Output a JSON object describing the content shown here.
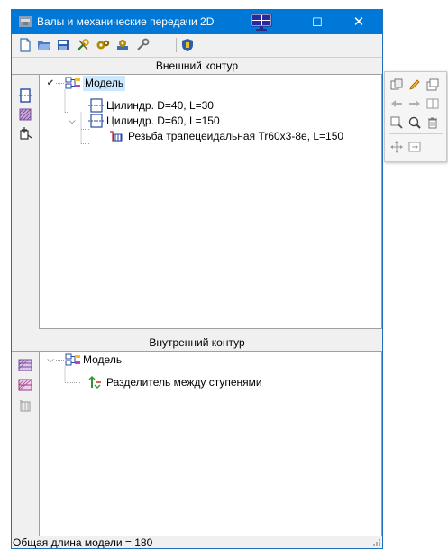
{
  "window": {
    "title": "Валы и механические передачи 2D",
    "buttons": {
      "maximize": "☐",
      "close": "✕"
    }
  },
  "toolbar": {
    "items": [
      "new-file-icon",
      "open-folder-icon",
      "save-icon",
      "tools-icon",
      "gears-icon",
      "settings-gear-icon",
      "wrench-icon",
      "library-icon"
    ]
  },
  "outer": {
    "header": "Внешний контур",
    "tree": {
      "root": "Модель",
      "children": [
        {
          "label": "Цилиндр. D=40, L=30"
        },
        {
          "label": "Цилиндр. D=60, L=150",
          "children": [
            {
              "label": "Резьба трапецеидальная Tr60x3-8e, L=150"
            }
          ]
        }
      ]
    }
  },
  "inner": {
    "header": "Внутренний контур",
    "tree": {
      "root": "Модель",
      "children": [
        {
          "label": "Разделитель между ступенями"
        }
      ]
    }
  },
  "status": {
    "text": "Общая длина модели = 180"
  },
  "colors": {
    "titlebar": "#0078d7",
    "selection": "#cce8ff",
    "panel_bg": "#f0f0f0"
  }
}
